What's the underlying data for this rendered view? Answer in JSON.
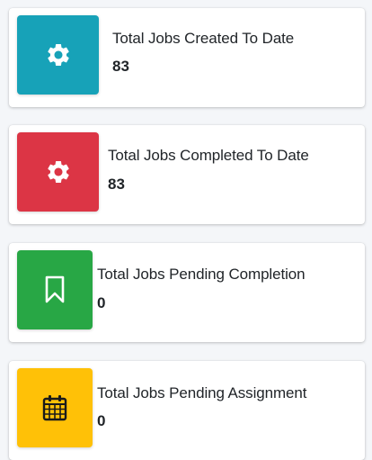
{
  "colors": {
    "info": "#17a2b8",
    "danger": "#dc3545",
    "success": "#28a745",
    "warning": "#ffc107"
  },
  "cards": [
    {
      "title": "Total Jobs Created To Date",
      "value": "83",
      "icon": "gear-icon",
      "color": "#17a2b8"
    },
    {
      "title": "Total Jobs Completed To Date",
      "value": "83",
      "icon": "gear-icon",
      "color": "#dc3545"
    },
    {
      "title": "Total Jobs Pending Completion",
      "value": "0",
      "icon": "bookmark-icon",
      "color": "#28a745"
    },
    {
      "title": "Total Jobs Pending Assignment",
      "value": "0",
      "icon": "calendar-icon",
      "color": "#ffc107"
    }
  ]
}
